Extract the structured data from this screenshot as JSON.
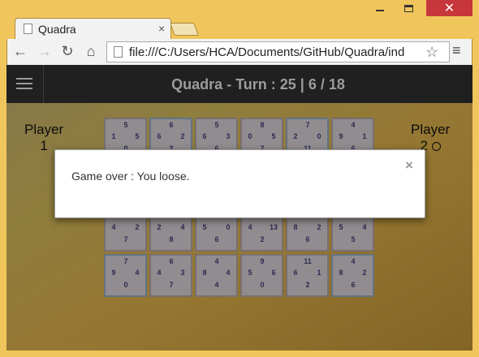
{
  "window": {
    "minimize_icon": "minimize-icon",
    "maximize_icon": "maximize-icon",
    "close_glyph": "✕"
  },
  "tab": {
    "title": "Quadra",
    "close_glyph": "×"
  },
  "toolbar": {
    "back_glyph": "←",
    "forward_glyph": "→",
    "reload_glyph": "↻",
    "home_glyph": "⌂",
    "url": "file:///C:/Users/HCA/Documents/GitHub/Quadra/ind",
    "star_glyph": "☆",
    "menu_glyph": "≡"
  },
  "app": {
    "title": "Quadra - Turn : 25 | 6 / 18",
    "player1_label": "Player",
    "player1_number": "1",
    "player2_label": "Player",
    "player2_number": "2",
    "colors": {
      "navbar": "#202020",
      "card_text": "#3c3c6e",
      "red_border": "#a89a9a",
      "blue_border": "#8aa0b7"
    }
  },
  "board": {
    "rows": [
      [
        {
          "t": "5",
          "l": "1",
          "r": "5",
          "b": "0",
          "owner": "red"
        },
        {
          "t": "6",
          "l": "6",
          "r": "2",
          "b": "2",
          "owner": "blue"
        },
        {
          "t": "5",
          "l": "6",
          "r": "3",
          "b": "6",
          "owner": "red"
        },
        {
          "t": "8",
          "l": "0",
          "r": "5",
          "b": "7",
          "owner": "red"
        },
        {
          "t": "7",
          "l": "2",
          "r": "0",
          "b": "11",
          "owner": "blue"
        },
        {
          "t": "4",
          "l": "9",
          "r": "1",
          "b": "6",
          "owner": "red"
        }
      ],
      [
        {
          "t": "",
          "l": "",
          "r": "",
          "b": "",
          "owner": "red"
        },
        {
          "t": "",
          "l": "",
          "r": "",
          "b": "",
          "owner": "red"
        },
        {
          "t": "",
          "l": "",
          "r": "",
          "b": "",
          "owner": "red"
        },
        {
          "t": "",
          "l": "",
          "r": "",
          "b": "",
          "owner": "red"
        },
        {
          "t": "",
          "l": "",
          "r": "",
          "b": "",
          "owner": "red"
        },
        {
          "t": "",
          "l": "",
          "r": "",
          "b": "",
          "owner": "red"
        }
      ],
      [
        {
          "t": "",
          "l": "4",
          "r": "2",
          "b": "7",
          "owner": "red"
        },
        {
          "t": "",
          "l": "2",
          "r": "4",
          "b": "8",
          "owner": "red"
        },
        {
          "t": "",
          "l": "5",
          "r": "0",
          "b": "6",
          "owner": "red"
        },
        {
          "t": "",
          "l": "4",
          "r": "13",
          "b": "2",
          "owner": "red"
        },
        {
          "t": "",
          "l": "8",
          "r": "2",
          "b": "6",
          "owner": "red"
        },
        {
          "t": "",
          "l": "5",
          "r": "4",
          "b": "5",
          "owner": "red"
        }
      ],
      [
        {
          "t": "7",
          "l": "9",
          "r": "4",
          "b": "0",
          "owner": "blue"
        },
        {
          "t": "6",
          "l": "4",
          "r": "3",
          "b": "7",
          "owner": "red"
        },
        {
          "t": "4",
          "l": "8",
          "r": "4",
          "b": "4",
          "owner": "red"
        },
        {
          "t": "9",
          "l": "5",
          "r": "6",
          "b": "0",
          "owner": "red"
        },
        {
          "t": "11",
          "l": "6",
          "r": "1",
          "b": "2",
          "owner": "red"
        },
        {
          "t": "4",
          "l": "8",
          "r": "2",
          "b": "6",
          "owner": "blue"
        }
      ]
    ]
  },
  "modal": {
    "message": "Game over : You loose.",
    "close_glyph": "×"
  }
}
